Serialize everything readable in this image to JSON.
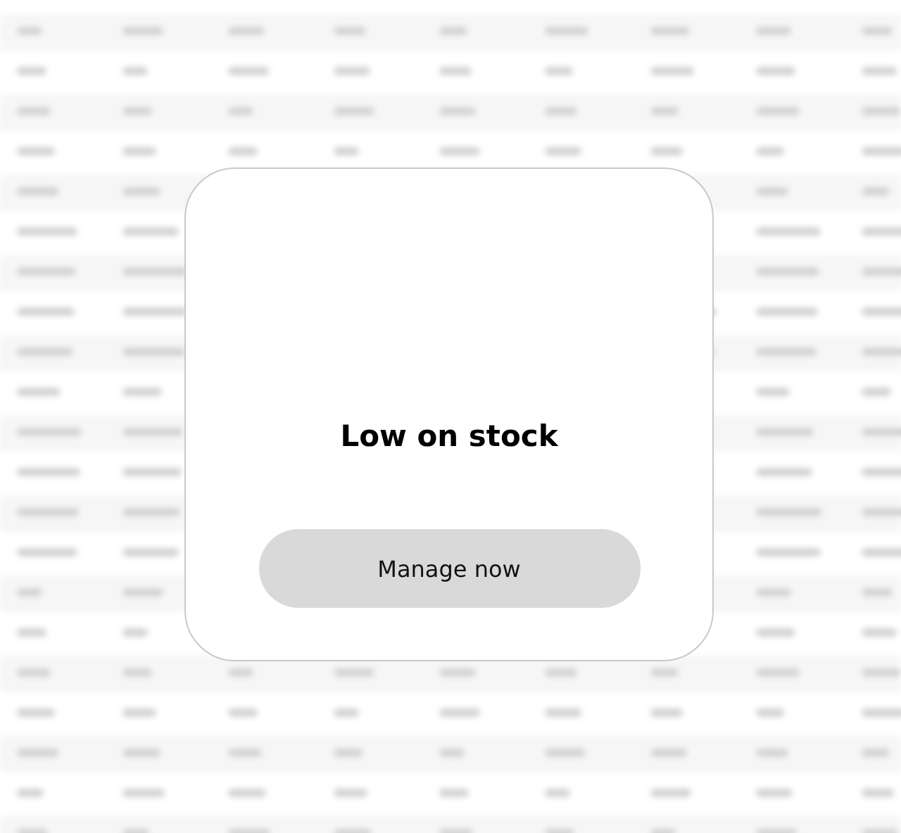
{
  "dialog": {
    "title": "Low on stock",
    "button": "Manage now"
  }
}
